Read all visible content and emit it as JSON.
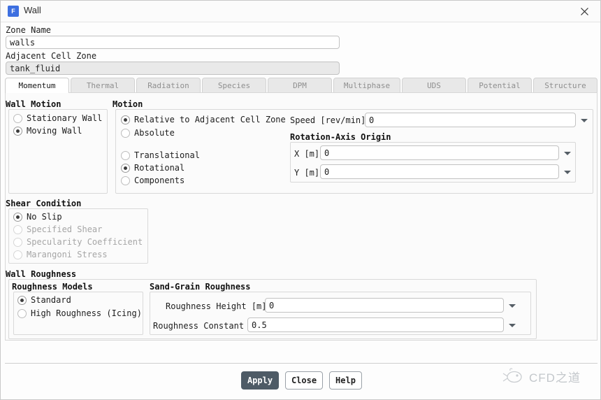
{
  "window": {
    "title": "Wall",
    "icon": "fluent-app-icon",
    "icon_letter": "F",
    "close_icon": "close-icon"
  },
  "zone": {
    "name_label": "Zone Name",
    "name_value": "walls",
    "adjacent_label": "Adjacent Cell Zone",
    "adjacent_value": "tank_fluid"
  },
  "tabs": [
    {
      "label": "Momentum",
      "active": true
    },
    {
      "label": "Thermal",
      "active": false
    },
    {
      "label": "Radiation",
      "active": false
    },
    {
      "label": "Species",
      "active": false
    },
    {
      "label": "DPM",
      "active": false
    },
    {
      "label": "Multiphase",
      "active": false
    },
    {
      "label": "UDS",
      "active": false
    },
    {
      "label": "Potential",
      "active": false
    },
    {
      "label": "Structure",
      "active": false
    }
  ],
  "wall_motion": {
    "title": "Wall Motion",
    "options": [
      {
        "label": "Stationary Wall",
        "selected": false
      },
      {
        "label": "Moving Wall",
        "selected": true
      }
    ]
  },
  "motion": {
    "title": "Motion",
    "frame_options": [
      {
        "label": "Relative to Adjacent Cell Zone",
        "selected": true
      },
      {
        "label": "Absolute",
        "selected": false
      }
    ],
    "type_options": [
      {
        "label": "Translational",
        "selected": false
      },
      {
        "label": "Rotational",
        "selected": true
      },
      {
        "label": "Components",
        "selected": false
      }
    ],
    "speed_label": "Speed [rev/min]",
    "speed_value": "0",
    "origin_title": "Rotation-Axis Origin",
    "origin_fields": [
      {
        "label": "X [m]",
        "value": "0"
      },
      {
        "label": "Y [m]",
        "value": "0"
      }
    ]
  },
  "shear": {
    "title": "Shear Condition",
    "options": [
      {
        "label": "No Slip",
        "selected": true,
        "enabled": true
      },
      {
        "label": "Specified Shear",
        "selected": false,
        "enabled": false
      },
      {
        "label": "Specularity Coefficient",
        "selected": false,
        "enabled": false
      },
      {
        "label": "Marangoni Stress",
        "selected": false,
        "enabled": false
      }
    ]
  },
  "roughness": {
    "title": "Wall Roughness",
    "models_title": "Roughness Models",
    "models": [
      {
        "label": "Standard",
        "selected": true
      },
      {
        "label": "High Roughness (Icing)",
        "selected": false
      }
    ],
    "sand_grain_title": "Sand-Grain Roughness",
    "fields": [
      {
        "label": "Roughness Height [m]",
        "value": "0"
      },
      {
        "label": "Roughness Constant",
        "value": "0.5"
      }
    ]
  },
  "footer": {
    "buttons": [
      {
        "label": "Apply",
        "style": "primary"
      },
      {
        "label": "Close",
        "style": "ghost"
      },
      {
        "label": "Help",
        "style": "ghost"
      }
    ],
    "watermark_text": "CFD之道",
    "watermark_icon": "cfd-logo-icon"
  },
  "colors": {
    "accent": "#3d6fe0",
    "primary_button": "#4e5b66",
    "panel_bg": "#fbfbfb",
    "field_disabled": "#e9e9e9"
  }
}
